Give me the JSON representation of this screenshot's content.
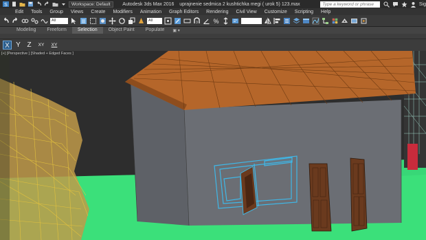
{
  "titlebar": {
    "workspace": "Workspace: Default",
    "app_title": "Autodesk 3ds Max 2016",
    "file_title": "uprajnenie sedmica 2 kushtichka megi ( urok 5) 123.max",
    "search_placeholder": "Type a keyword or phrase",
    "signin": "Sig"
  },
  "menu": [
    "Edit",
    "Tools",
    "Group",
    "Views",
    "Create",
    "Modifiers",
    "Animation",
    "Graph Editors",
    "Rendering",
    "Civil View",
    "Customize",
    "Scripting",
    "Help"
  ],
  "toolbar": {
    "selection_filter": "All"
  },
  "ribbon": {
    "tabs": [
      "Modeling",
      "Freeform",
      "Selection",
      "Object Paint",
      "Populate"
    ],
    "active": "Selection",
    "extra": "▣ ▾"
  },
  "axis": {
    "buttons": [
      "X",
      "Y",
      "Z",
      "XY",
      "XY"
    ],
    "active": "X"
  },
  "viewport": {
    "label": "[+] [Perspective ] [Shaded + Edged Faces ]"
  },
  "colors": {
    "ground": "#3be07a",
    "wall": "#6b6e74",
    "roof": "#b5662a",
    "selection": "#3fb8e8",
    "door": "#6a3a1e"
  }
}
